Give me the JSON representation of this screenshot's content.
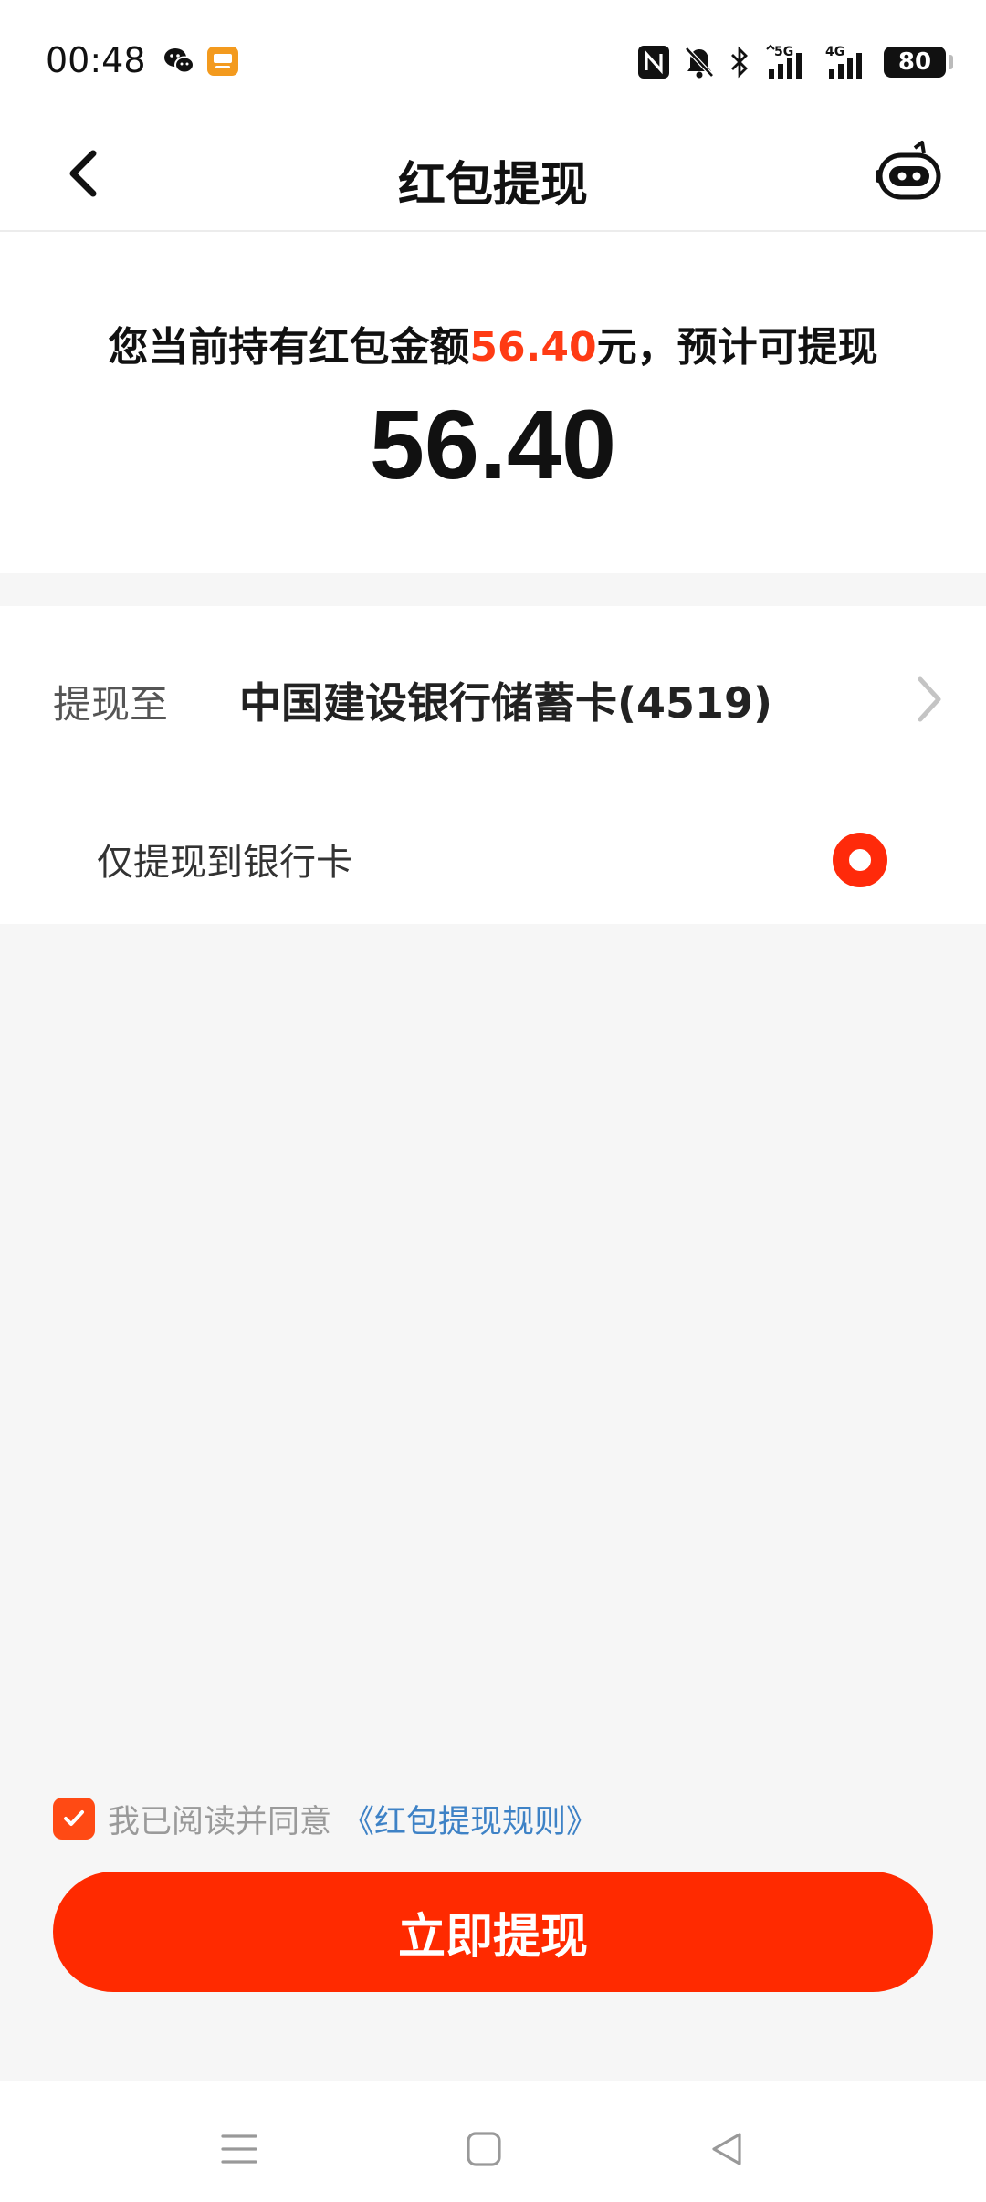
{
  "status_bar": {
    "time": "00:48",
    "battery": "80",
    "icons": [
      "wechat-icon",
      "app-icon",
      "nfc-icon",
      "mute-bell-icon",
      "bluetooth-icon",
      "signal-5g-icon",
      "signal-4g-icon",
      "battery-icon"
    ]
  },
  "header": {
    "title": "红包提现",
    "back_icon": "chevron-left-icon",
    "assistant_icon": "robot-icon"
  },
  "summary": {
    "prefix": "您当前持有红包金额",
    "amount_inline": "56.40",
    "suffix": "元，预计可提现",
    "amount": "56.40",
    "accent_color": "#ff3b14"
  },
  "withdraw": {
    "label": "提现至",
    "bank": "中国建设银行储蓄卡(4519)",
    "option_label": "仅提现到银行卡",
    "option_selected": true
  },
  "agreement": {
    "checked": true,
    "text": "我已阅读并同意",
    "link": "《红包提现规则》"
  },
  "submit": {
    "label": "立即提现",
    "color": "#ff2a00"
  },
  "system_nav": {
    "icons": [
      "menu-icon",
      "home-icon",
      "back-triangle-icon"
    ]
  }
}
